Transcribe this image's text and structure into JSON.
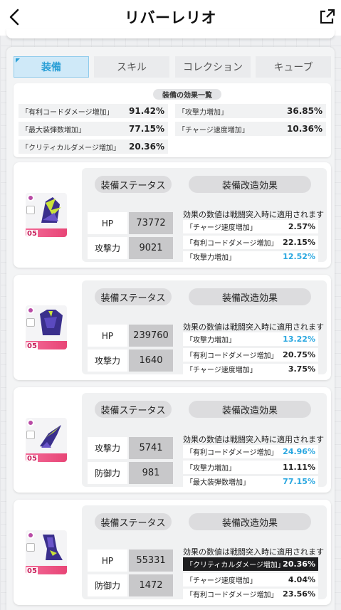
{
  "header": {
    "title": "リバーレリオ"
  },
  "tabs": [
    {
      "label": "装備",
      "active": true
    },
    {
      "label": "スキル",
      "active": false
    },
    {
      "label": "コレクション",
      "active": false
    },
    {
      "label": "キューブ",
      "active": false
    }
  ],
  "summary": {
    "title": "装備の効果一覧",
    "rows": [
      {
        "label": "「有利コードダメージ増加」",
        "value": "91.42%"
      },
      {
        "label": "「攻撃力増加」",
        "value": "36.85%"
      },
      {
        "label": "「最大装弾数増加」",
        "value": "77.15%"
      },
      {
        "label": "「チャージ速度増加」",
        "value": "10.36%"
      },
      {
        "label": "「クリティカルダメージ増加」",
        "value": "20.36%"
      }
    ]
  },
  "gear": [
    {
      "level": "05",
      "status_label": "装備ステータス",
      "mod_label": "装備改造効果",
      "note": "効果の数値は戦闘突入時に適用されます",
      "stats": [
        {
          "label": "HP",
          "value": "73772"
        },
        {
          "label": "攻撃力",
          "value": "9021"
        }
      ],
      "effects": [
        {
          "label": "「チャージ速度増加」",
          "value": "2.57%",
          "highlight": false
        },
        {
          "label": "「有利コードダメージ増加」",
          "value": "22.15%",
          "highlight": false
        },
        {
          "label": "「攻撃力増加」",
          "value": "12.52%",
          "highlight": true
        }
      ]
    },
    {
      "level": "05",
      "status_label": "装備ステータス",
      "mod_label": "装備改造効果",
      "note": "効果の数値は戦闘突入時に適用されます",
      "stats": [
        {
          "label": "HP",
          "value": "239760"
        },
        {
          "label": "攻撃力",
          "value": "1640"
        }
      ],
      "effects": [
        {
          "label": "「攻撃力増加」",
          "value": "13.22%",
          "highlight": true
        },
        {
          "label": "「有利コードダメージ増加」",
          "value": "20.75%",
          "highlight": false
        },
        {
          "label": "「チャージ速度増加」",
          "value": "3.75%",
          "highlight": false
        }
      ]
    },
    {
      "level": "05",
      "status_label": "装備ステータス",
      "mod_label": "装備改造効果",
      "note": "効果の数値は戦闘突入時に適用されます",
      "stats": [
        {
          "label": "攻撃力",
          "value": "5741"
        },
        {
          "label": "防御力",
          "value": "981"
        }
      ],
      "effects": [
        {
          "label": "「有利コードダメージ増加」",
          "value": "24.96%",
          "highlight": true
        },
        {
          "label": "「攻撃力増加」",
          "value": "11.11%",
          "highlight": false
        },
        {
          "label": "「最大装弾数増加」",
          "value": "77.15%",
          "highlight": true
        }
      ]
    },
    {
      "level": "05",
      "status_label": "装備ステータス",
      "mod_label": "装備改造効果",
      "note": "効果の数値は戦闘突入時に適用されます",
      "stats": [
        {
          "label": "HP",
          "value": "55331"
        },
        {
          "label": "防御力",
          "value": "1472"
        }
      ],
      "effects": [
        {
          "label": "「クリティカルダメージ増加」",
          "value": "20.36%",
          "highlight": true,
          "dark": true
        },
        {
          "label": "「チャージ速度増加」",
          "value": "4.04%",
          "highlight": false
        },
        {
          "label": "「有利コードダメージ増加」",
          "value": "23.56%",
          "highlight": false
        }
      ]
    }
  ]
}
